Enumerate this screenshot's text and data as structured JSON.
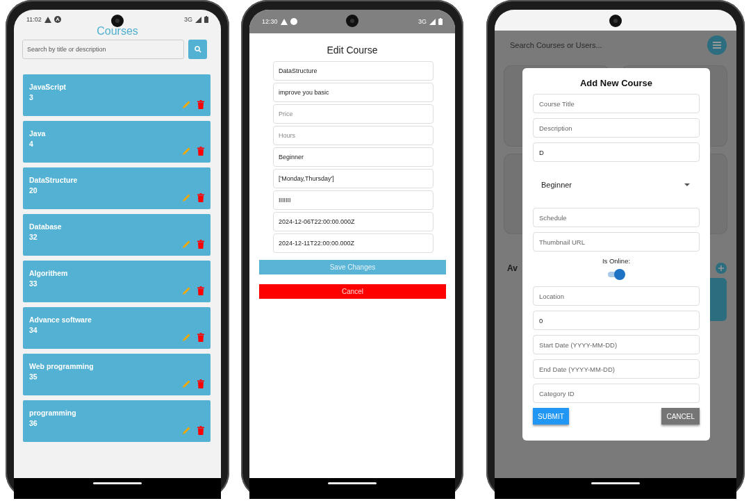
{
  "courses_screen": {
    "status_bar": {
      "time": "11:02",
      "network": "3G"
    },
    "title": "Courses",
    "search": {
      "placeholder": "Search by title or description"
    },
    "courses": [
      {
        "title": "JavaScript",
        "count": "3"
      },
      {
        "title": "Java",
        "count": "4"
      },
      {
        "title": "DataStructure",
        "count": "20"
      },
      {
        "title": "Database",
        "count": "32"
      },
      {
        "title": "Algorithem",
        "count": "33"
      },
      {
        "title": "Advance software",
        "count": "34"
      },
      {
        "title": "Web programming",
        "count": "35"
      },
      {
        "title": "programming",
        "count": "36"
      }
    ]
  },
  "edit_course_screen": {
    "status_bar": {
      "time": "12:30",
      "network": "3G"
    },
    "title": "Edit Course",
    "fields": [
      {
        "value": "DataStructure"
      },
      {
        "value": "improve you basic"
      },
      {
        "placeholder": "Price"
      },
      {
        "placeholder": "Hours"
      },
      {
        "value": "Beginner"
      },
      {
        "value": "['Monday,Thursday']"
      },
      {
        "value": "IIIIIII"
      },
      {
        "value": "2024-12-06T22:00:00.000Z"
      },
      {
        "value": "2024-12-11T22:00:00.000Z"
      }
    ],
    "buttons": [
      {
        "label": "Save Changes",
        "kind": "primary"
      },
      {
        "label": "Cancel",
        "kind": "danger"
      }
    ]
  },
  "add_course_screen": {
    "background": {
      "search_placeholder": "Search Courses or Users...",
      "section_title": "Av"
    },
    "dialog": {
      "title": "Add New Course",
      "fields": [
        {
          "kind": "text",
          "placeholder": "Course Title"
        },
        {
          "kind": "text",
          "placeholder": "Description"
        },
        {
          "kind": "text",
          "value": "D"
        },
        {
          "kind": "select",
          "value": "Beginner"
        },
        {
          "kind": "text",
          "placeholder": "Schedule"
        },
        {
          "kind": "text",
          "placeholder": "Thumbnail URL"
        },
        {
          "kind": "switch",
          "label": "Is Online:",
          "on": true
        },
        {
          "kind": "text",
          "placeholder": "Location"
        },
        {
          "kind": "text",
          "value": "0"
        },
        {
          "kind": "text",
          "placeholder": "Start Date (YYYY-MM-DD)"
        },
        {
          "kind": "text",
          "placeholder": "End Date (YYYY-MM-DD)"
        },
        {
          "kind": "text",
          "placeholder": "Category ID"
        }
      ],
      "buttons": [
        {
          "label": "SUBMIT",
          "kind": "primary"
        },
        {
          "label": "CANCEL",
          "kind": "secondary"
        }
      ]
    }
  }
}
